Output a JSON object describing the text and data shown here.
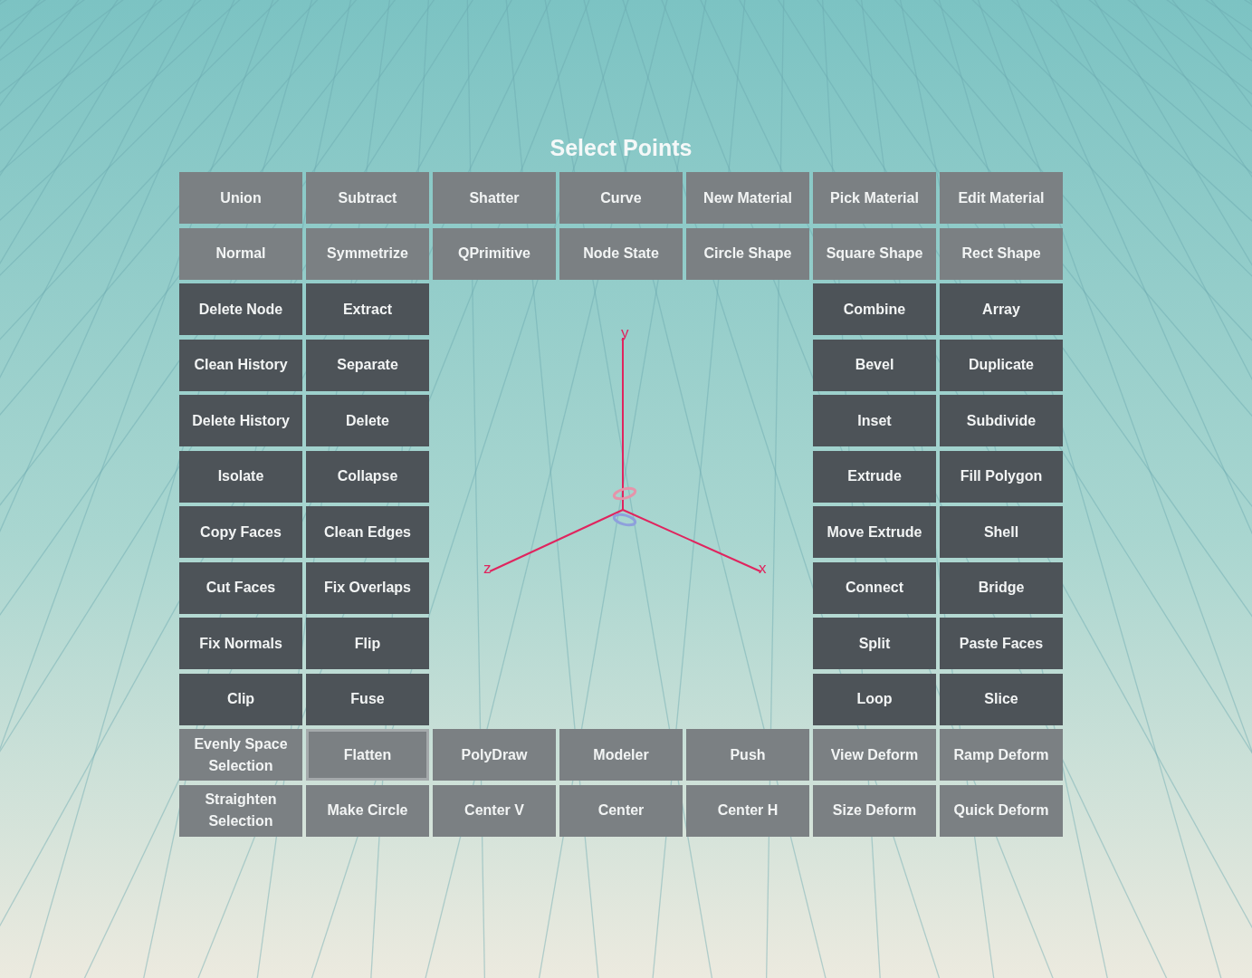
{
  "title": "Select Points",
  "top_rows": [
    [
      {
        "label": "Union",
        "kind": "light",
        "selected": false
      },
      {
        "label": "Subtract",
        "kind": "light",
        "selected": false
      },
      {
        "label": "Shatter",
        "kind": "light",
        "selected": false
      },
      {
        "label": "Curve",
        "kind": "light",
        "selected": false
      },
      {
        "label": "New Material",
        "kind": "light",
        "selected": false
      },
      {
        "label": "Pick Material",
        "kind": "light",
        "selected": false
      },
      {
        "label": "Edit Material",
        "kind": "light",
        "selected": false
      }
    ],
    [
      {
        "label": "Normal",
        "kind": "light",
        "selected": false
      },
      {
        "label": "Symmetrize",
        "kind": "light",
        "selected": false
      },
      {
        "label": "QPrimitive",
        "kind": "light",
        "selected": false
      },
      {
        "label": "Node State",
        "kind": "light",
        "selected": false
      },
      {
        "label": "Circle Shape",
        "kind": "light",
        "selected": false
      },
      {
        "label": "Square Shape",
        "kind": "light",
        "selected": false
      },
      {
        "label": "Rect Shape",
        "kind": "light",
        "selected": false
      }
    ]
  ],
  "left_block": [
    {
      "label": "Delete Node",
      "kind": "dark",
      "selected": false
    },
    {
      "label": "Extract",
      "kind": "dark",
      "selected": false
    },
    {
      "label": "Clean History",
      "kind": "dark",
      "selected": false
    },
    {
      "label": "Separate",
      "kind": "dark",
      "selected": false
    },
    {
      "label": "Delete History",
      "kind": "dark",
      "selected": false
    },
    {
      "label": "Delete",
      "kind": "dark",
      "selected": false
    },
    {
      "label": "Isolate",
      "kind": "dark",
      "selected": false
    },
    {
      "label": "Collapse",
      "kind": "dark",
      "selected": false
    },
    {
      "label": "Copy Faces",
      "kind": "dark",
      "selected": false
    },
    {
      "label": "Clean Edges",
      "kind": "dark",
      "selected": false
    },
    {
      "label": "Cut Faces",
      "kind": "dark",
      "selected": false
    },
    {
      "label": "Fix Overlaps",
      "kind": "dark",
      "selected": false
    },
    {
      "label": "Fix Normals",
      "kind": "dark",
      "selected": false
    },
    {
      "label": "Flip",
      "kind": "dark",
      "selected": false
    },
    {
      "label": "Clip",
      "kind": "dark",
      "selected": false
    },
    {
      "label": "Fuse",
      "kind": "dark",
      "selected": false
    }
  ],
  "axes": {
    "x_label": "x",
    "y_label": "y",
    "z_label": "z"
  },
  "right_block": [
    {
      "label": "Combine",
      "kind": "dark",
      "selected": false
    },
    {
      "label": "Array",
      "kind": "dark",
      "selected": false
    },
    {
      "label": "Bevel",
      "kind": "dark",
      "selected": false
    },
    {
      "label": "Duplicate",
      "kind": "dark",
      "selected": false
    },
    {
      "label": "Inset",
      "kind": "dark",
      "selected": false
    },
    {
      "label": "Subdivide",
      "kind": "dark",
      "selected": false
    },
    {
      "label": "Extrude",
      "kind": "dark",
      "selected": false
    },
    {
      "label": "Fill Polygon",
      "kind": "dark",
      "selected": false
    },
    {
      "label": "Move Extrude",
      "kind": "dark",
      "selected": false
    },
    {
      "label": "Shell",
      "kind": "dark",
      "selected": false
    },
    {
      "label": "Connect",
      "kind": "dark",
      "selected": false
    },
    {
      "label": "Bridge",
      "kind": "dark",
      "selected": false
    },
    {
      "label": "Split",
      "kind": "dark",
      "selected": false
    },
    {
      "label": "Paste Faces",
      "kind": "dark",
      "selected": false
    },
    {
      "label": "Loop",
      "kind": "dark",
      "selected": false
    },
    {
      "label": "Slice",
      "kind": "dark",
      "selected": false
    }
  ],
  "bottom_rows": [
    [
      {
        "label": "Evenly Space Selection",
        "kind": "light",
        "selected": false
      },
      {
        "label": "Flatten",
        "kind": "light",
        "selected": true
      },
      {
        "label": "PolyDraw",
        "kind": "light",
        "selected": false
      },
      {
        "label": "Modeler",
        "kind": "light",
        "selected": false
      },
      {
        "label": "Push",
        "kind": "light",
        "selected": false
      },
      {
        "label": "View Deform",
        "kind": "light",
        "selected": false
      },
      {
        "label": "Ramp Deform",
        "kind": "light",
        "selected": false
      }
    ],
    [
      {
        "label": "Straighten Selection",
        "kind": "light",
        "selected": false
      },
      {
        "label": "Make Circle",
        "kind": "light",
        "selected": false
      },
      {
        "label": "Center V",
        "kind": "light",
        "selected": false
      },
      {
        "label": "Center",
        "kind": "light",
        "selected": false
      },
      {
        "label": "Center H",
        "kind": "light",
        "selected": false
      },
      {
        "label": "Size Deform",
        "kind": "light",
        "selected": false
      },
      {
        "label": "Quick Deform",
        "kind": "light",
        "selected": false
      }
    ]
  ]
}
